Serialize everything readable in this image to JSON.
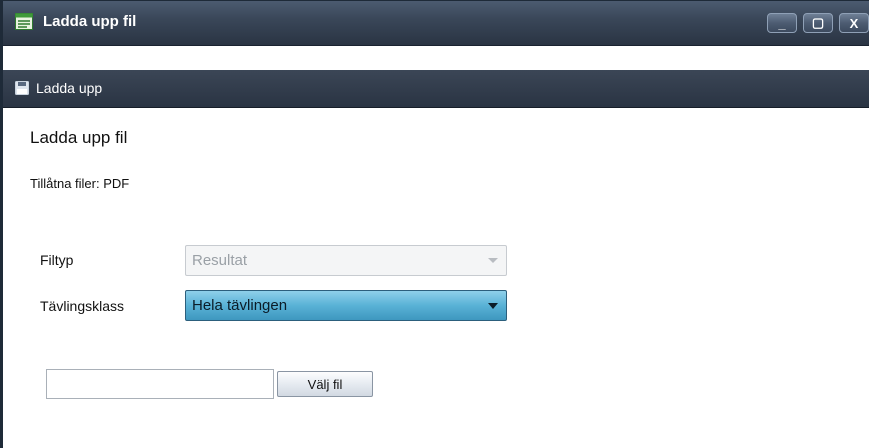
{
  "window": {
    "title": "Ladda upp fil",
    "minimize_label": "_",
    "maximize_label": "▢",
    "close_label": "X"
  },
  "toolbar": {
    "upload_label": "Ladda upp"
  },
  "main": {
    "heading": "Ladda upp fil",
    "allowed_files": "Tillåtna filer: PDF",
    "filtyp": {
      "label": "Filtyp",
      "value": "Resultat",
      "disabled": true
    },
    "tavlingsklass": {
      "label": "Tävlingsklass",
      "value": "Hela tävlingen"
    },
    "file": {
      "value": "",
      "button_label": "Välj fil"
    }
  },
  "colors": {
    "titlebar": "#3a4759",
    "select_active": "#59b2d6"
  }
}
